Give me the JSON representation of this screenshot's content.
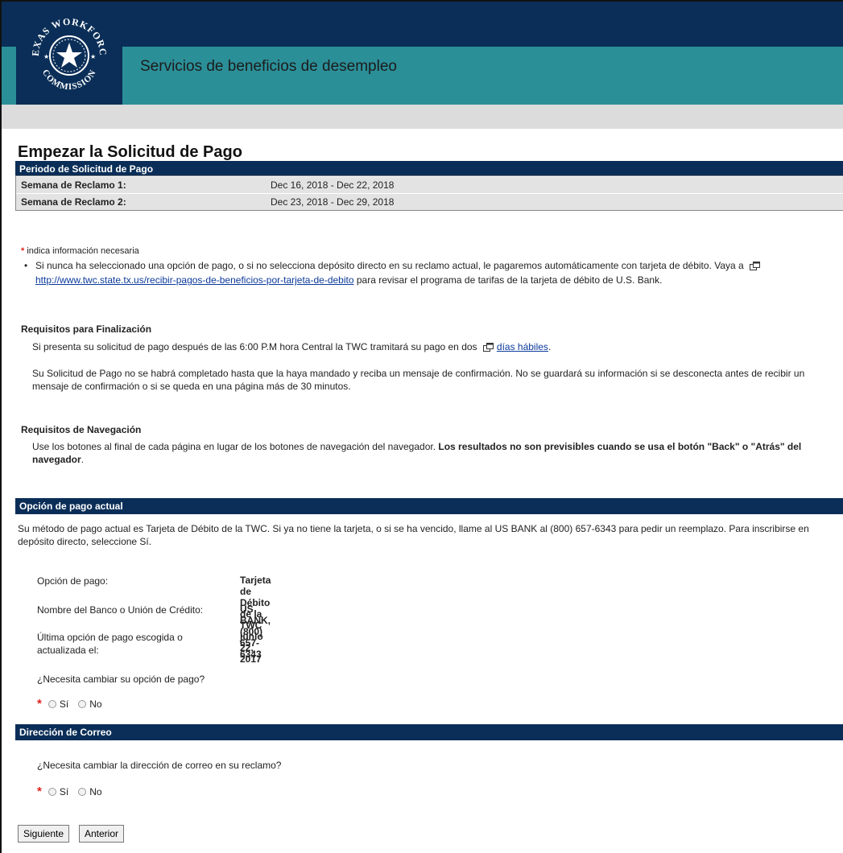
{
  "header": {
    "logo_text_top": "TEXAS WORKFORCE",
    "logo_text_bottom": "COMMISSION",
    "app_title": "Servicios de beneficios de desempleo",
    "colors": {
      "navy": "#0a2e57",
      "teal": "#2b8f98",
      "gray": "#dcdcdc"
    }
  },
  "page": {
    "title": "Empezar la Solicitud de Pago"
  },
  "period": {
    "header": "Periodo de Solicitud de Pago",
    "rows": [
      {
        "label": "Semana de Reclamo 1:",
        "value": "Dec 16, 2018 - Dec 22, 2018"
      },
      {
        "label": "Semana de Reclamo 2:",
        "value": "Dec 23, 2018 - Dec 29, 2018"
      }
    ]
  },
  "required_note": "indica información necesaria",
  "bullet": {
    "text_before": "Si nunca ha seleccionado una opción de pago, o si no selecciona depósito directo en su reclamo actual, le pagaremos automáticamente con tarjeta de débito. Vaya a",
    "link": "http://www.twc.state.tx.us/recibir-pagos-de-beneficios-por-tarjeta-de-debito",
    "text_after": "para revisar el programa de tarifas de la tarjeta de débito de U.S. Bank."
  },
  "finalization": {
    "heading": "Requisitos para Finalización",
    "p1_before": "Si presenta su solicitud de pago después de las 6:00 P.M hora Central la TWC tramitará su pago en dos",
    "p1_link": "días hábiles",
    "p1_after": ".",
    "p2": "Su Solicitud de Pago no se habrá completado hasta que la haya mandado y reciba un mensaje de confirmación. No se guardará su información si se desconecta antes de recibir un mensaje de confirmación o si se queda en una página más de 30 minutos."
  },
  "navigation": {
    "heading": "Requisitos de Navegación",
    "p_normal": "Use los botones al final de cada página en lugar de los botones de navegación del navegador.",
    "p_bold": "Los resultados no son previsibles cuando se usa el botón \"Back\" o \"Atrás\" del navegador",
    "p_end": "."
  },
  "payment": {
    "header": "Opción de pago actual",
    "intro": "Su método de pago actual es Tarjeta de Débito de la TWC. Si ya no tiene la tarjeta, o si se ha vencido, llame al US BANK al (800) 657-6343 para pedir un reemplazo. Para inscribirse en depósito directo, seleccione Sí.",
    "rows": [
      {
        "label": "Opción de pago:",
        "value": "Tarjeta de Débito de la TWC"
      },
      {
        "label": "Nombre del Banco o Unión de Crédito:",
        "value": "US BANK, (800) 657-6343"
      },
      {
        "label": "Última opción de pago escogida o actualizada el:",
        "value": "junio 22, 2017"
      }
    ],
    "question": "¿Necesita cambiar su opción de pago?",
    "yes": "Sí",
    "no": "No"
  },
  "mailing": {
    "header": "Dirección de Correo",
    "question": "¿Necesita cambiar la dirección de correo en su reclamo?",
    "yes": "Sí",
    "no": "No"
  },
  "buttons": {
    "next": "Siguiente",
    "prev": "Anterior"
  }
}
